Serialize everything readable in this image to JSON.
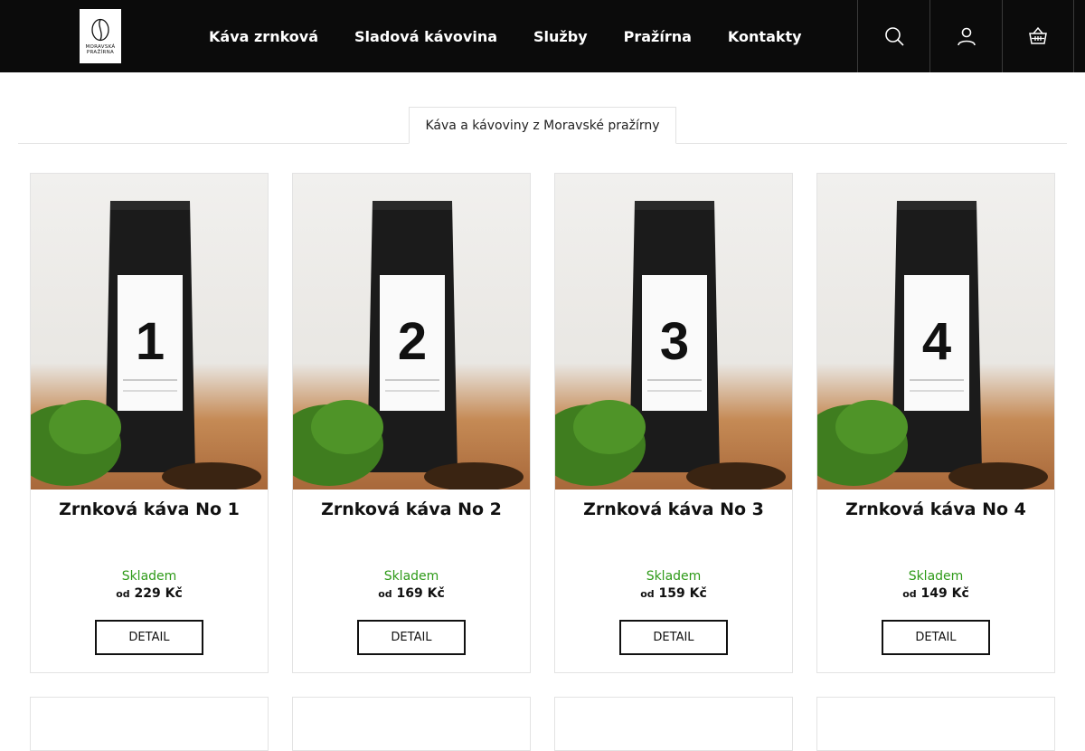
{
  "header": {
    "logo_line1": "MORAVSKÁ",
    "logo_line2": "PRAŽÍRNA",
    "nav": [
      "Káva zrnková",
      "Sladová kávovina",
      "Služby",
      "Pražírna",
      "Kontakty"
    ],
    "icons": [
      "search-icon",
      "user-icon",
      "cart-icon"
    ],
    "bg_color": "#0b0b0b"
  },
  "tabs": {
    "active": "Káva a kávoviny z Moravské pražírny"
  },
  "products": [
    {
      "number": "1",
      "name": "Zrnková káva No 1",
      "stock": "Skladem",
      "price_prefix": "od",
      "price": "229 Kč",
      "button": "DETAIL"
    },
    {
      "number": "2",
      "name": "Zrnková káva No 2",
      "stock": "Skladem",
      "price_prefix": "od",
      "price": "169 Kč",
      "button": "DETAIL"
    },
    {
      "number": "3",
      "name": "Zrnková káva No 3",
      "stock": "Skladem",
      "price_prefix": "od",
      "price": "159 Kč",
      "button": "DETAIL"
    },
    {
      "number": "4",
      "name": "Zrnková káva No 4",
      "stock": "Skladem",
      "price_prefix": "od",
      "price": "149 Kč",
      "button": "DETAIL"
    }
  ],
  "colors": {
    "stock": "#2e9a18"
  }
}
